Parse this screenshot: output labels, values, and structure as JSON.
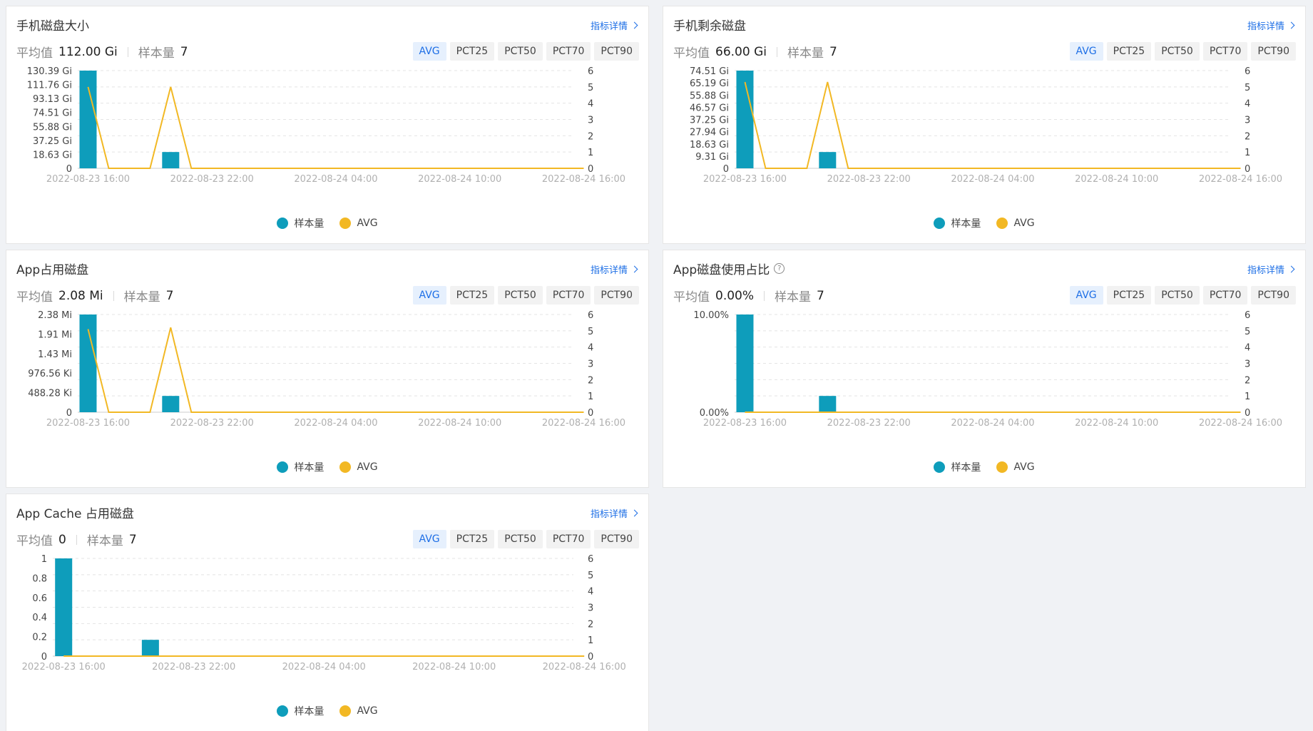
{
  "detail_link_label": "指标详情",
  "stat_avg_label": "平均值",
  "stat_count_label": "样本量",
  "tabs": [
    "AVG",
    "PCT25",
    "PCT50",
    "PCT70",
    "PCT90"
  ],
  "legend": {
    "count": "样本量",
    "avg": "AVG"
  },
  "colors": {
    "bar": "#0e9dbb",
    "line": "#f2b824",
    "accent": "#1e6fe6"
  },
  "x_ticks": [
    "2022-08-23 16:00",
    "2022-08-23 22:00",
    "2022-08-24 04:00",
    "2022-08-24 10:00",
    "2022-08-24 16:00"
  ],
  "cards": [
    {
      "title": "手机磁盘大小",
      "help": false,
      "avg_value": "112.00 Gi",
      "count_value": "7",
      "chart_data": {
        "type": "bar",
        "left_ticks": [
          "0",
          "18.63 Gi",
          "37.25 Gi",
          "55.88 Gi",
          "74.51 Gi",
          "93.13 Gi",
          "111.76 Gi",
          "130.39 Gi"
        ],
        "right_ticks": [
          "0",
          "1",
          "2",
          "3",
          "4",
          "5",
          "6"
        ],
        "ylim_left": [
          0,
          130.39
        ],
        "ylim_right": [
          0,
          6
        ],
        "bars": [
          {
            "x": 0,
            "value": 6
          },
          {
            "x": 4,
            "value": 1
          }
        ],
        "avg_line": [
          [
            0,
            5
          ],
          [
            1,
            0
          ],
          [
            3,
            0
          ],
          [
            4,
            5
          ],
          [
            5,
            0
          ],
          [
            24,
            0
          ]
        ]
      }
    },
    {
      "title": "手机剩余磁盘",
      "help": false,
      "avg_value": "66.00 Gi",
      "count_value": "7",
      "chart_data": {
        "type": "bar",
        "left_ticks": [
          "0",
          "9.31 Gi",
          "18.63 Gi",
          "27.94 Gi",
          "37.25 Gi",
          "46.57 Gi",
          "55.88 Gi",
          "65.19 Gi",
          "74.51 Gi"
        ],
        "right_ticks": [
          "0",
          "1",
          "2",
          "3",
          "4",
          "5",
          "6"
        ],
        "ylim_left": [
          0,
          74.51
        ],
        "ylim_right": [
          0,
          6
        ],
        "bars": [
          {
            "x": 0,
            "value": 6
          },
          {
            "x": 4,
            "value": 1
          }
        ],
        "avg_line": [
          [
            0,
            5.3
          ],
          [
            1,
            0
          ],
          [
            3,
            0
          ],
          [
            4,
            5.3
          ],
          [
            5,
            0
          ],
          [
            24,
            0
          ]
        ]
      }
    },
    {
      "title": "App占用磁盘",
      "help": false,
      "avg_value": "2.08 Mi",
      "count_value": "7",
      "chart_data": {
        "type": "bar",
        "left_ticks": [
          "0",
          "488.28 Ki",
          "976.56 Ki",
          "1.43 Mi",
          "1.91 Mi",
          "2.38 Mi"
        ],
        "right_ticks": [
          "0",
          "1",
          "2",
          "3",
          "4",
          "5",
          "6"
        ],
        "ylim_left": [
          0,
          2.38
        ],
        "ylim_right": [
          0,
          6
        ],
        "bars": [
          {
            "x": 0,
            "value": 6
          },
          {
            "x": 4,
            "value": 1
          }
        ],
        "avg_line": [
          [
            0,
            5.1
          ],
          [
            1,
            0
          ],
          [
            3,
            0
          ],
          [
            4,
            5.2
          ],
          [
            5,
            0
          ],
          [
            24,
            0
          ]
        ]
      }
    },
    {
      "title": "App磁盘使用占比",
      "help": true,
      "avg_value": "0.00%",
      "count_value": "7",
      "chart_data": {
        "type": "bar",
        "left_ticks": [
          "0.00%",
          "10.00%"
        ],
        "right_ticks": [
          "0",
          "1",
          "2",
          "3",
          "4",
          "5",
          "6"
        ],
        "ylim_left": [
          0,
          10
        ],
        "ylim_right": [
          0,
          6
        ],
        "bars": [
          {
            "x": 0,
            "value": 6
          },
          {
            "x": 4,
            "value": 1
          }
        ],
        "avg_line": [
          [
            0,
            0
          ],
          [
            24,
            0
          ]
        ]
      }
    },
    {
      "title": "App Cache 占用磁盘",
      "help": false,
      "avg_value": "0",
      "count_value": "7",
      "chart_data": {
        "type": "bar",
        "left_ticks": [
          "0",
          "0.2",
          "0.4",
          "0.6",
          "0.8",
          "1"
        ],
        "right_ticks": [
          "0",
          "1",
          "2",
          "3",
          "4",
          "5",
          "6"
        ],
        "ylim_left": [
          0,
          1
        ],
        "ylim_right": [
          0,
          6
        ],
        "bars": [
          {
            "x": 0,
            "value": 6
          },
          {
            "x": 4,
            "value": 1
          }
        ],
        "avg_line": [
          [
            0,
            0
          ],
          [
            24,
            0
          ]
        ]
      }
    }
  ]
}
